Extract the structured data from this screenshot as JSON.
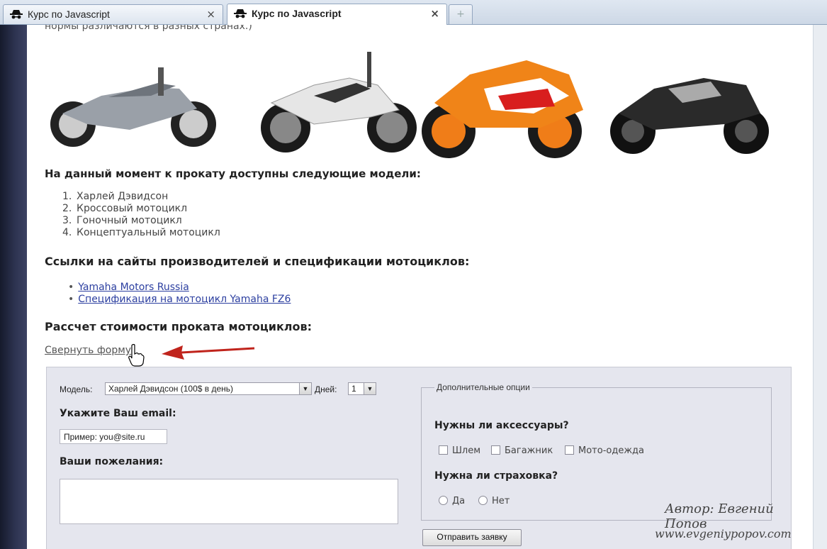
{
  "browser": {
    "tabs": [
      {
        "label": "Курс по Javascript",
        "close": "×",
        "icon": "spy-icon"
      },
      {
        "label": "Курс по Javascript",
        "close": "×",
        "icon": "spy-icon"
      }
    ],
    "new_tab": "+"
  },
  "page": {
    "cut_text": "нормы различаются в разных странах.)",
    "available_heading": "На данный момент к прокату доступны следующие модели:",
    "models": [
      {
        "num": "1.",
        "name": "Харлей Дэвидсон"
      },
      {
        "num": "2.",
        "name": "Кроссовый мотоцикл"
      },
      {
        "num": "3.",
        "name": "Гоночный мотоцикл"
      },
      {
        "num": "4.",
        "name": "Концептуальный мотоцикл"
      }
    ],
    "links_heading": "Ссылки на сайты производителей и спецификации мотоциклов:",
    "links": [
      "Yamaha Motors Russia",
      "Спецификация на мотоцикл Yamaha FZ6"
    ],
    "calc_heading": "Рассчет стоимости проката мотоциклов:",
    "collapse_link": "Свернуть форму"
  },
  "form": {
    "model_label": "Модель:",
    "model_value": "Харлей Дэвидсон (100$ в день)",
    "days_label": "Дней:",
    "days_value": "1",
    "email_heading": "Укажите Ваш email:",
    "email_value": "Пример: you@site.ru",
    "wishes_heading": "Ваши пожелания:",
    "options_legend": "Дополнительные опции",
    "accessories_heading": "Нужны ли аксессуары?",
    "accessories": [
      "Шлем",
      "Багажник",
      "Мото-одежда"
    ],
    "insurance_heading": "Нужна ли страховка?",
    "insurance": [
      "Да",
      "Нет"
    ],
    "submit": "Отправить заявку"
  },
  "watermark": {
    "author": "Автор: Евгений Попов",
    "site": "www.evgeniypopov.com"
  },
  "colors": {
    "link": "#2c3fa0",
    "arrow": "#c0241c",
    "panel": "#e5e6ee"
  }
}
